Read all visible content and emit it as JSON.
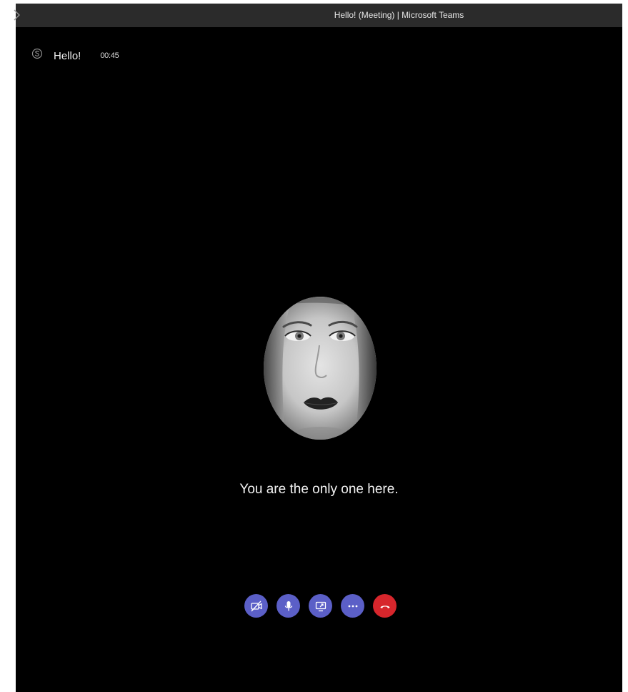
{
  "window": {
    "title": "Hello! (Meeting) | Microsoft Teams"
  },
  "meeting": {
    "icon": "skype-icon",
    "name": "Hello!",
    "timer": "00:45"
  },
  "participant": {
    "avatar": "participant-avatar"
  },
  "status": {
    "message": "You are the only one here."
  },
  "controls": [
    {
      "name": "camera-off",
      "icon": "video-off-icon"
    },
    {
      "name": "microphone",
      "icon": "microphone-icon"
    },
    {
      "name": "share-screen",
      "icon": "share-screen-icon"
    },
    {
      "name": "more-options",
      "icon": "more-icon"
    },
    {
      "name": "hang-up",
      "icon": "hang-up-icon"
    }
  ],
  "colors": {
    "control_accent": "#5b5fc7",
    "hangup": "#d7262c",
    "background": "#000000",
    "titlebar": "#2b2b2b"
  }
}
